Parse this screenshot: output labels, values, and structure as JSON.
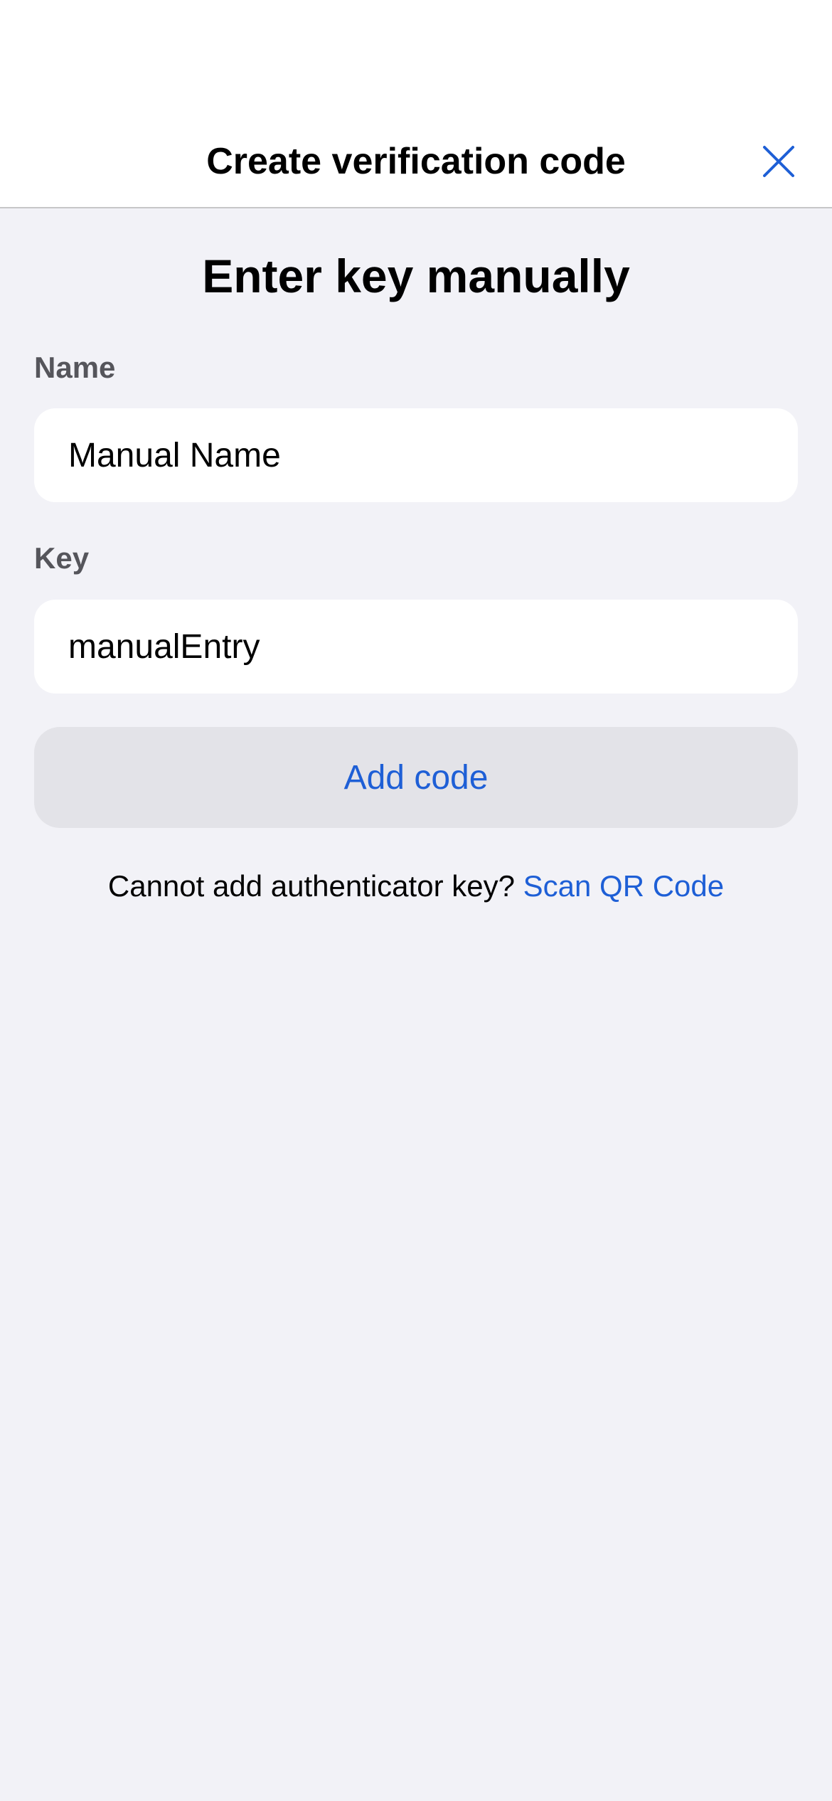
{
  "header": {
    "title": "Create verification code"
  },
  "main": {
    "heading": "Enter key manually",
    "name_field": {
      "label": "Name",
      "value": "Manual Name"
    },
    "key_field": {
      "label": "Key",
      "value": "manualEntry"
    },
    "add_button_label": "Add code",
    "hint": {
      "text": "Cannot add authenticator key?",
      "link": "Scan QR Code"
    }
  },
  "icons": {
    "close": "close-icon"
  },
  "colors": {
    "accent": "#1E5FD6",
    "background": "#F2F2F7",
    "button_bg": "#E3E3E8"
  }
}
